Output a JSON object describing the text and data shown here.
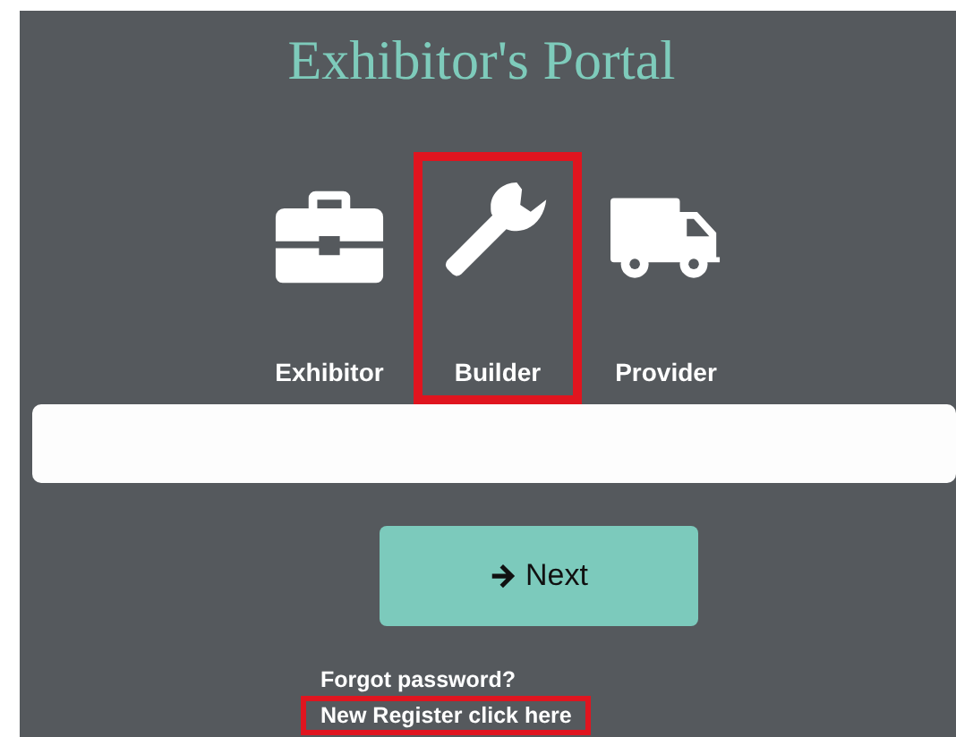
{
  "title": "Exhibitor's Portal",
  "roles": [
    {
      "kind": "briefcase",
      "label": "Exhibitor",
      "selected": false
    },
    {
      "kind": "wrench",
      "label": "Builder",
      "selected": true
    },
    {
      "kind": "truck",
      "label": "Provider",
      "selected": false
    }
  ],
  "next_button": {
    "label": "Next"
  },
  "links": [
    {
      "label": "Forgot password?",
      "highlighted": false
    },
    {
      "label": "New Register click here",
      "highlighted": true
    }
  ]
}
